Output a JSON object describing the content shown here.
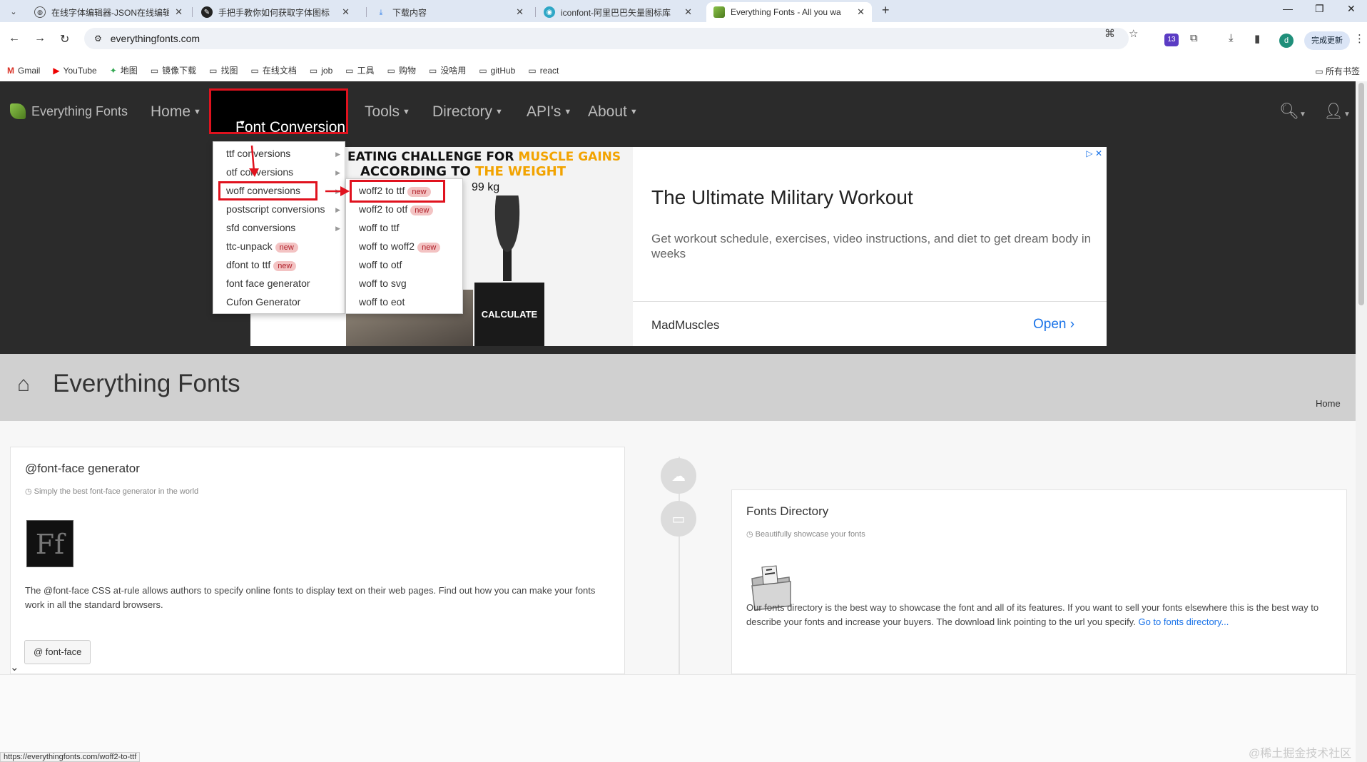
{
  "browser": {
    "tabs": [
      {
        "title": "在线字体编辑器-JSON在线编辑",
        "favicon": "globe-icon"
      },
      {
        "title": "手把手教你如何获取字体图标",
        "favicon": "juejin-icon"
      },
      {
        "title": "下载内容",
        "favicon": "download-icon"
      },
      {
        "title": "iconfont-阿里巴巴矢量图标库",
        "favicon": "iconfont-icon"
      },
      {
        "title": "Everything Fonts - All you wa",
        "favicon": "everythingfonts-icon",
        "active": true
      }
    ],
    "url": "everythingfonts.com",
    "extension_badge": "13",
    "profile_initial": "d",
    "update_label": "完成更新",
    "bookmarks": [
      {
        "label": "Gmail",
        "icon": "gmail-icon"
      },
      {
        "label": "YouTube",
        "icon": "youtube-icon"
      },
      {
        "label": "地图",
        "icon": "maps-icon"
      },
      {
        "label": "镜像下载",
        "icon": "folder-icon"
      },
      {
        "label": "找图",
        "icon": "folder-icon"
      },
      {
        "label": "在线文档",
        "icon": "folder-icon"
      },
      {
        "label": "job",
        "icon": "folder-icon"
      },
      {
        "label": "工具",
        "icon": "folder-icon"
      },
      {
        "label": "购物",
        "icon": "folder-icon"
      },
      {
        "label": "没啥用",
        "icon": "folder-icon"
      },
      {
        "label": "gitHub",
        "icon": "folder-icon"
      },
      {
        "label": "react",
        "icon": "folder-icon"
      }
    ],
    "all_bookmarks": "所有书签",
    "status_url": "https://everythingfonts.com/woff2-to-ttf"
  },
  "site": {
    "brand": "Everything Fonts",
    "nav": {
      "home": "Home",
      "font_conversion": "Font Conversion",
      "tools": "Tools",
      "directory": "Directory",
      "apis": "API's",
      "about": "About"
    },
    "dropdown": {
      "items": [
        {
          "label": "ttf conversions",
          "submenu": true
        },
        {
          "label": "otf conversions",
          "submenu": true
        },
        {
          "label": "woff conversions",
          "submenu": true
        },
        {
          "label": "postscript conversions",
          "submenu": true
        },
        {
          "label": "sfd conversions",
          "submenu": true
        },
        {
          "label": "ttc-unpack",
          "badge": "new"
        },
        {
          "label": "dfont to ttf",
          "badge": "new"
        },
        {
          "label": "font face generator"
        },
        {
          "label": "Cufon Generator"
        }
      ],
      "woff_submenu": [
        {
          "label": "woff2 to ttf",
          "badge": "new"
        },
        {
          "label": "woff2 to otf",
          "badge": "new"
        },
        {
          "label": "woff to ttf"
        },
        {
          "label": "woff to woff2",
          "badge": "new"
        },
        {
          "label": "woff to otf"
        },
        {
          "label": "woff to svg"
        },
        {
          "label": "woff to eot"
        }
      ]
    },
    "ad": {
      "image_headline_1a": "EATING CHALLENGE FOR ",
      "image_headline_1b": "MUSCLE GAINS",
      "image_headline_2a": "ACCORDING TO ",
      "image_headline_2b": "THE WEIGHT",
      "image_weight": "99 kg",
      "image_button": "CALCULATE",
      "title": "The Ultimate Military Workout",
      "description": "Get workout schedule, exercises, video instructions, and diet to get dream body in weeks",
      "advertiser": "MadMuscles",
      "cta": "Open"
    },
    "page_title": "Everything Fonts",
    "breadcrumb": "Home",
    "cards": {
      "fontface": {
        "title": "@font-face generator",
        "subtitle": "Simply the best font-face generator in the world",
        "logo_text": "Ff",
        "body": "The @font-face CSS at-rule allows authors to specify online fonts to display text on their web pages. Find out how you can make your fonts work in all the standard browsers.",
        "button": "@ font-face"
      },
      "directory": {
        "title": "Fonts Directory",
        "subtitle": "Beautifully showcase your fonts",
        "body": "Our fonts directory is the best way to showcase the font and all of its features. If you want to sell your fonts elsewhere this is the best way to describe your fonts and increase your buyers. The download link pointing to the url you specify. ",
        "link": "Go to fonts directory..."
      }
    },
    "watermark": "@稀土掘金技术社区"
  },
  "colors": {
    "highlight": "#e0121e",
    "nav_bg": "#2b2b2b",
    "link": "#1a73e8",
    "badge_bg": "#f3c3c3"
  }
}
